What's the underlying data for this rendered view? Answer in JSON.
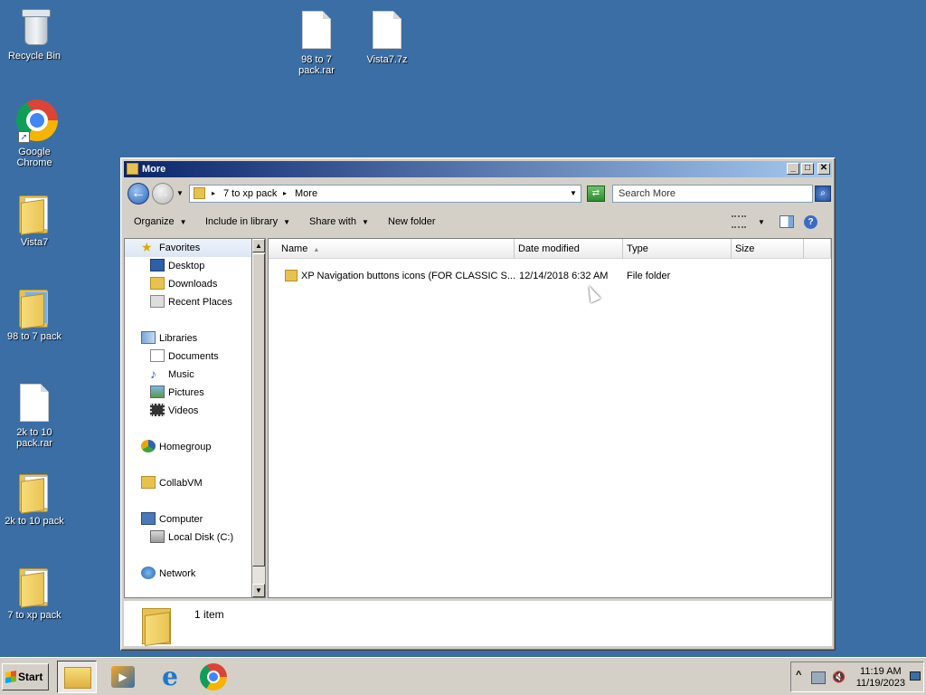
{
  "desktop": {
    "icons": [
      {
        "label": "Recycle Bin"
      },
      {
        "label": "Google Chrome"
      },
      {
        "label": "Vista7"
      },
      {
        "label": "98 to 7 pack"
      },
      {
        "label": "2k to 10 pack.rar"
      },
      {
        "label": "2k to 10 pack"
      },
      {
        "label": "7 to xp pack"
      },
      {
        "label": "98 to 7 pack.rar"
      },
      {
        "label": "Vista7.7z"
      }
    ]
  },
  "window": {
    "title": "More",
    "controls": {
      "minimize": "_",
      "maximize": "□",
      "close": "✕"
    },
    "address": {
      "separator": "▸",
      "crumbs": [
        "7 to xp pack",
        "More"
      ]
    },
    "search": {
      "placeholder": "Search More"
    },
    "toolbar": {
      "organize": "Organize",
      "include_in_library": "Include in library",
      "share_with": "Share with",
      "new_folder": "New folder"
    },
    "nav": {
      "favorites": "Favorites",
      "desktop": "Desktop",
      "downloads": "Downloads",
      "recent_places": "Recent Places",
      "libraries": "Libraries",
      "documents": "Documents",
      "music": "Music",
      "pictures": "Pictures",
      "videos": "Videos",
      "homegroup": "Homegroup",
      "collabvm": "CollabVM",
      "computer": "Computer",
      "local_disk": "Local Disk (C:)",
      "network": "Network"
    },
    "columns": {
      "name": "Name",
      "date_modified": "Date modified",
      "type": "Type",
      "size": "Size"
    },
    "files": [
      {
        "name": "XP Navigation buttons icons (FOR CLASSIC S...",
        "date_modified": "12/14/2018 6:32 AM",
        "type": "File folder",
        "size": ""
      }
    ],
    "details": {
      "item_count": "1 item"
    }
  },
  "taskbar": {
    "start_label": "Start",
    "tray_arrow": "^",
    "clock_time": "11:19 AM",
    "clock_date": "11/19/2023"
  },
  "colors": {
    "desktop_bg": "#3a6ea5",
    "titlebar_start": "#0a246a",
    "titlebar_end": "#a6caf0",
    "folder": "#e8c24e"
  }
}
